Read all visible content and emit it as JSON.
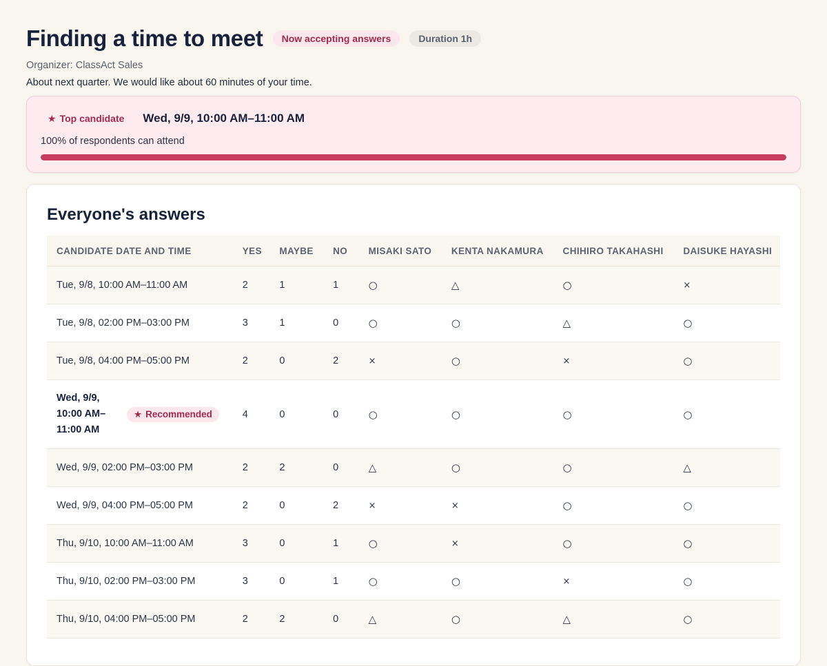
{
  "header": {
    "title": "Finding a time to meet",
    "status_badge": "Now accepting answers",
    "duration_badge": "Duration 1h",
    "organizer": "Organizer: ClassAct Sales",
    "description": "About next quarter. We would like about 60 minutes of your time."
  },
  "top_candidate": {
    "label": "Top candidate",
    "time": "Wed, 9/9, 10:00 AM–11:00 AM",
    "attendance_text": "100% of respondents can attend",
    "attendance_fraction": 1.0
  },
  "answers": {
    "title": "Everyone's answers",
    "columns": [
      "CANDIDATE DATE AND TIME",
      "YES",
      "MAYBE",
      "NO",
      "MISAKI SATO",
      "KENTA NAKAMURA",
      "CHIHIRO TAKAHASHI",
      "DAISUKE HAYASHI"
    ],
    "recommended_label": "Recommended",
    "rows": [
      {
        "time": "Tue, 9/8, 10:00 AM–11:00 AM",
        "yes": "2",
        "maybe": "1",
        "no": "1",
        "marks": [
          "○",
          "△",
          "○",
          "×"
        ]
      },
      {
        "time": "Tue, 9/8, 02:00 PM–03:00 PM",
        "yes": "3",
        "maybe": "1",
        "no": "0",
        "marks": [
          "○",
          "○",
          "△",
          "○"
        ]
      },
      {
        "time": "Tue, 9/8, 04:00 PM–05:00 PM",
        "yes": "2",
        "maybe": "0",
        "no": "2",
        "marks": [
          "×",
          "○",
          "×",
          "○"
        ]
      },
      {
        "time": "Wed, 9/9, 10:00 AM–11:00 AM",
        "yes": "4",
        "maybe": "0",
        "no": "0",
        "marks": [
          "○",
          "○",
          "○",
          "○"
        ],
        "recommended": true
      },
      {
        "time": "Wed, 9/9, 02:00 PM–03:00 PM",
        "yes": "2",
        "maybe": "2",
        "no": "0",
        "marks": [
          "△",
          "○",
          "○",
          "△"
        ]
      },
      {
        "time": "Wed, 9/9, 04:00 PM–05:00 PM",
        "yes": "2",
        "maybe": "0",
        "no": "2",
        "marks": [
          "×",
          "×",
          "○",
          "○"
        ]
      },
      {
        "time": "Thu, 9/10, 10:00 AM–11:00 AM",
        "yes": "3",
        "maybe": "0",
        "no": "1",
        "marks": [
          "○",
          "×",
          "○",
          "○"
        ]
      },
      {
        "time": "Thu, 9/10, 02:00 PM–03:00 PM",
        "yes": "3",
        "maybe": "0",
        "no": "1",
        "marks": [
          "○",
          "○",
          "×",
          "○"
        ]
      },
      {
        "time": "Thu, 9/10, 04:00 PM–05:00 PM",
        "yes": "2",
        "maybe": "2",
        "no": "0",
        "marks": [
          "△",
          "○",
          "△",
          "○"
        ]
      }
    ]
  },
  "icons": {
    "star": "star-icon"
  },
  "colors": {
    "accent": "#c93a5e",
    "accent_text": "#a52b4d",
    "accent_bg": "#fbe7ec",
    "page_bg": "#f9f6f0"
  }
}
